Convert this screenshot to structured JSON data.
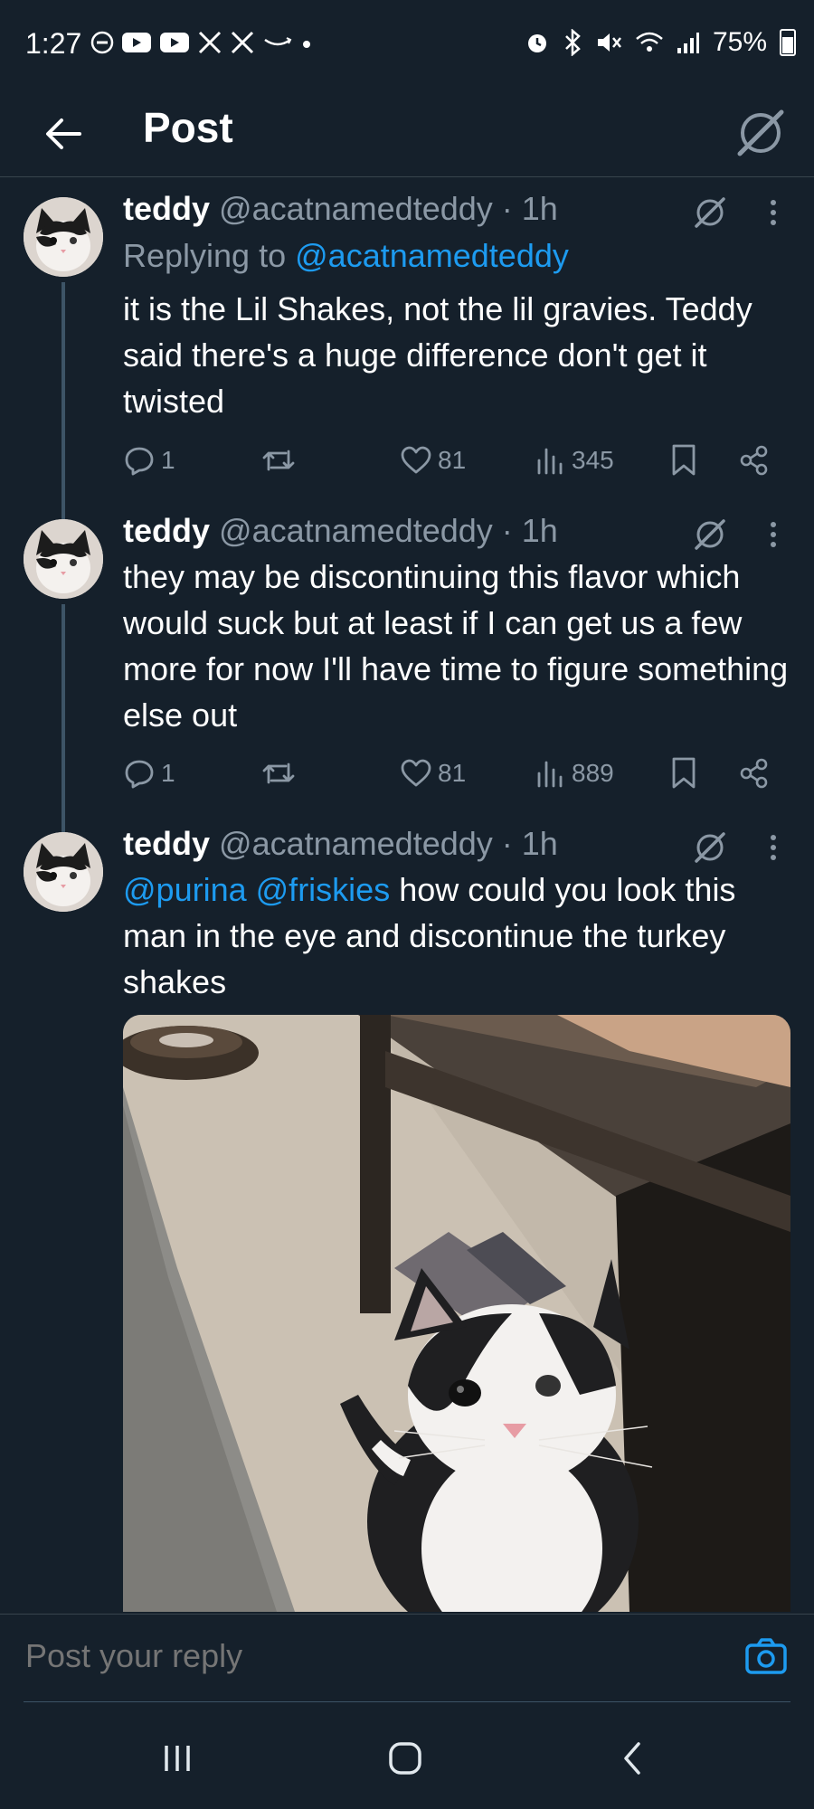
{
  "status_bar": {
    "time": "1:27",
    "battery": "75%",
    "left_icons": [
      "do-not-disturb-icon",
      "youtube-icon",
      "youtube-icon",
      "x-icon",
      "x-icon",
      "amazon-icon",
      "dot-icon"
    ],
    "right_icons": [
      "alarm-icon",
      "bluetooth-icon",
      "mute-icon",
      "wifi-icon",
      "signal-icon",
      "battery-icon"
    ]
  },
  "header": {
    "title": "Post"
  },
  "tweets": [
    {
      "name": "teddy",
      "handle": "@acatnamedteddy",
      "time": "· 1h",
      "replying_prefix": "Replying to",
      "replying_to": "@acatnamedteddy",
      "text": "it is the Lil Shakes, not the lil gravies. Teddy said there's a huge difference don't get it twisted",
      "replies": "1",
      "reposts": "",
      "likes": "81",
      "views": "345"
    },
    {
      "name": "teddy",
      "handle": "@acatnamedteddy",
      "time": "· 1h",
      "text": "they may be discontinuing this flavor which would suck but at least if I can get us a few more for now I'll have time to figure something else out",
      "replies": "1",
      "reposts": "",
      "likes": "81",
      "views": "889"
    },
    {
      "name": "teddy",
      "handle": "@acatnamedteddy",
      "time": "· 1h",
      "mention1": "@purina",
      "mention2": "@friskies",
      "text": "how could you look this man in the eye and discontinue the turkey shakes",
      "media": "photo of a black and white cat looking up under a table"
    }
  ],
  "reply_bar": {
    "placeholder": "Post your reply"
  },
  "colors": {
    "background": "#15202b",
    "accent": "#1d9bf0",
    "secondary_text": "#8b98a5",
    "divider": "#38444d"
  }
}
